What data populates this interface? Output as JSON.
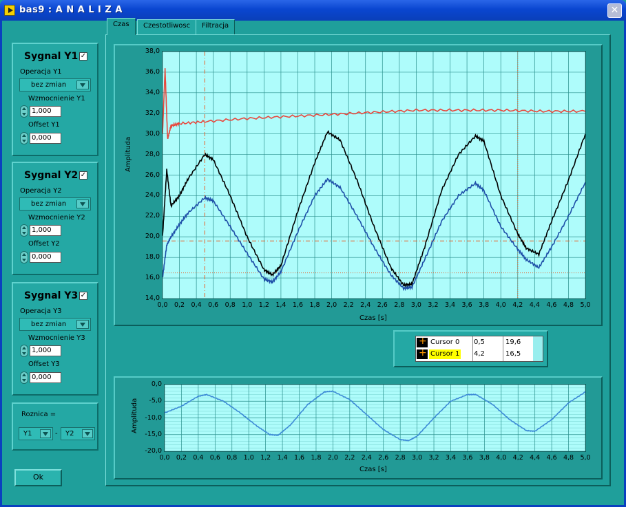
{
  "window": {
    "title": "bas9 : A N A L I Z A",
    "close_label": "✕"
  },
  "signals": [
    {
      "title": "Sygnal Y1",
      "checked": "✓",
      "operation_label": "Operacja Y1",
      "operation_value": "bez zmian",
      "gain_label": "Wzmocnienie Y1",
      "gain_value": "1,000",
      "offset_label": "Offset Y1",
      "offset_value": "0,000"
    },
    {
      "title": "Sygnal Y2",
      "checked": "✓",
      "operation_label": "Operacja Y2",
      "operation_value": "bez zmian",
      "gain_label": "Wzmocnienie Y2",
      "gain_value": "1,000",
      "offset_label": "Offset Y2",
      "offset_value": "0,000"
    },
    {
      "title": "Sygnal Y3",
      "checked": "✓",
      "operation_label": "Operacja Y3",
      "operation_value": "bez zmian",
      "gain_label": "Wzmocnienie Y3",
      "gain_value": "1,000",
      "offset_label": "Offset Y3",
      "offset_value": "0,000"
    }
  ],
  "difference": {
    "label": "Roznica =",
    "left": "Y1",
    "minus": "-",
    "right": "Y2"
  },
  "ok_label": "Ok",
  "tabs": [
    "Czas",
    "Czestotliwosc",
    "Filtracja"
  ],
  "colors": {
    "red": "#e8473c",
    "black": "#000000",
    "blue": "#1e4fa8",
    "diff": "#3c8ad6",
    "cursor": "#e8602a"
  },
  "cursors": [
    {
      "name": "Cursor 0",
      "x": "0,5",
      "y": "19,6"
    },
    {
      "name": "Cursor 1",
      "x": "4,2",
      "y": "16,5"
    }
  ],
  "chart_data": [
    {
      "type": "line",
      "xlabel": "Czas [s]",
      "ylabel": "Amplituda",
      "xlim": [
        0,
        5
      ],
      "ylim": [
        14,
        38
      ],
      "x_ticks": [
        "0,0",
        "0,2",
        "0,4",
        "0,6",
        "0,8",
        "1,0",
        "1,2",
        "1,4",
        "1,6",
        "1,8",
        "2,0",
        "2,2",
        "2,4",
        "2,6",
        "2,8",
        "3,0",
        "3,2",
        "3,4",
        "3,6",
        "3,8",
        "4,0",
        "4,2",
        "4,4",
        "4,6",
        "4,8",
        "5,0"
      ],
      "y_ticks": [
        "14,0",
        "16,0",
        "18,0",
        "20,0",
        "22,0",
        "24,0",
        "26,0",
        "28,0",
        "30,0",
        "32,0",
        "34,0",
        "36,0",
        "38,0"
      ],
      "grid": true,
      "series": [
        {
          "color": "#e8473c",
          "x": [
            0,
            0.03,
            0.06,
            0.1,
            0.2,
            0.5,
            1.0,
            1.5,
            2.0,
            2.5,
            3.0,
            3.5,
            4.0,
            4.5,
            5.0
          ],
          "y": [
            30,
            36.3,
            29.5,
            30.8,
            31.0,
            31.2,
            31.5,
            31.7,
            31.9,
            32.1,
            32.3,
            32.3,
            32.3,
            32.2,
            32.2
          ]
        },
        {
          "color": "#000000",
          "x": [
            0,
            0.05,
            0.1,
            0.2,
            0.3,
            0.5,
            0.6,
            0.8,
            1.0,
            1.2,
            1.3,
            1.4,
            1.6,
            1.8,
            1.95,
            2.1,
            2.3,
            2.5,
            2.7,
            2.85,
            2.95,
            3.1,
            3.3,
            3.5,
            3.7,
            3.8,
            4.0,
            4.2,
            4.3,
            4.45,
            4.6,
            4.8,
            5.0
          ],
          "y": [
            20,
            26.5,
            23.0,
            24.0,
            25.6,
            28.0,
            27.5,
            24.0,
            20.0,
            16.8,
            16.3,
            17.2,
            22.5,
            27.2,
            30.2,
            29.4,
            25.5,
            21.0,
            17.0,
            15.3,
            15.4,
            19.0,
            24.5,
            28.0,
            29.8,
            29.3,
            24.0,
            20.3,
            18.9,
            18.3,
            21.5,
            25.5,
            30.0
          ]
        },
        {
          "color": "#1e4fa8",
          "x": [
            0,
            0.05,
            0.1,
            0.2,
            0.3,
            0.5,
            0.6,
            0.8,
            1.0,
            1.2,
            1.3,
            1.4,
            1.6,
            1.8,
            1.95,
            2.1,
            2.3,
            2.5,
            2.7,
            2.85,
            2.95,
            3.1,
            3.3,
            3.5,
            3.7,
            3.8,
            4.0,
            4.2,
            4.3,
            4.45,
            4.6,
            4.8,
            5.0
          ],
          "y": [
            16,
            19.2,
            20.0,
            21.2,
            22.3,
            23.8,
            23.5,
            21.0,
            18.4,
            15.9,
            15.6,
            16.6,
            20.5,
            24.0,
            25.6,
            24.8,
            22.0,
            19.0,
            16.3,
            15.0,
            15.1,
            17.8,
            21.5,
            24.0,
            25.2,
            24.5,
            21.0,
            18.8,
            17.8,
            17.0,
            19.0,
            22.0,
            25.3
          ]
        }
      ],
      "cursor_lines": {
        "x": [
          0.5,
          4.2
        ],
        "y": [
          19.6,
          16.5
        ]
      }
    },
    {
      "type": "line",
      "xlabel": "Czas [s]",
      "ylabel": "Amplituda",
      "xlim": [
        0,
        5
      ],
      "ylim": [
        -20,
        0
      ],
      "x_ticks": [
        "0,0",
        "0,2",
        "0,4",
        "0,6",
        "0,8",
        "1,0",
        "1,2",
        "1,4",
        "1,6",
        "1,8",
        "2,0",
        "2,2",
        "2,4",
        "2,6",
        "2,8",
        "3,0",
        "3,2",
        "3,4",
        "3,6",
        "3,8",
        "4,0",
        "4,2",
        "4,4",
        "4,6",
        "4,8",
        "5,0"
      ],
      "y_ticks": [
        "-20,0",
        "-15,0",
        "-10,0",
        "-5,0",
        "0,0"
      ],
      "grid": true,
      "series": [
        {
          "color": "#3c8ad6",
          "x": [
            0,
            0.2,
            0.4,
            0.5,
            0.7,
            0.9,
            1.1,
            1.25,
            1.35,
            1.5,
            1.7,
            1.9,
            2.0,
            2.2,
            2.4,
            2.6,
            2.8,
            2.9,
            3.0,
            3.2,
            3.4,
            3.6,
            3.7,
            3.9,
            4.1,
            4.3,
            4.4,
            4.6,
            4.8,
            5.0
          ],
          "y": [
            -8.5,
            -6.5,
            -3.5,
            -3.0,
            -5.0,
            -8.5,
            -12.5,
            -15.0,
            -15.2,
            -12.0,
            -6.0,
            -2.2,
            -2.0,
            -4.5,
            -9.0,
            -13.5,
            -16.5,
            -16.8,
            -15.5,
            -10.0,
            -5.0,
            -3.0,
            -3.0,
            -6.0,
            -10.5,
            -13.8,
            -14.0,
            -10.5,
            -5.5,
            -2.2
          ]
        }
      ]
    }
  ]
}
